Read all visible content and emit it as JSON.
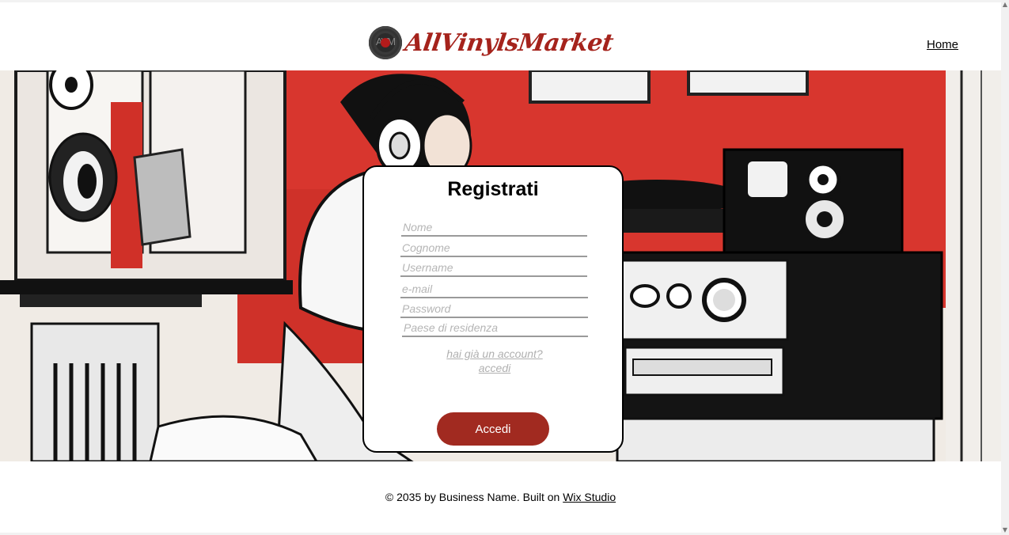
{
  "brand": {
    "logo_letters": "AVM",
    "name": "AllVinylsMarket",
    "color": "#a5231c"
  },
  "nav": {
    "home_label": "Home"
  },
  "form": {
    "title": "Registrati",
    "fields": {
      "nome": "Nome",
      "cognome": "Cognome",
      "username": "Username",
      "email": "e-mail",
      "password": "Password",
      "paese": "Paese di residenza"
    },
    "login_link_line1": "hai già un account?",
    "login_link_line2": "accedi",
    "submit_label": "Accedi",
    "accent": "#a12a20"
  },
  "footer": {
    "text": "© 2035 by Business Name. Built on",
    "link_label": "Wix Studio"
  },
  "icons": {
    "scroll_up": "scroll-up-arrow",
    "scroll_down": "scroll-down-arrow"
  }
}
